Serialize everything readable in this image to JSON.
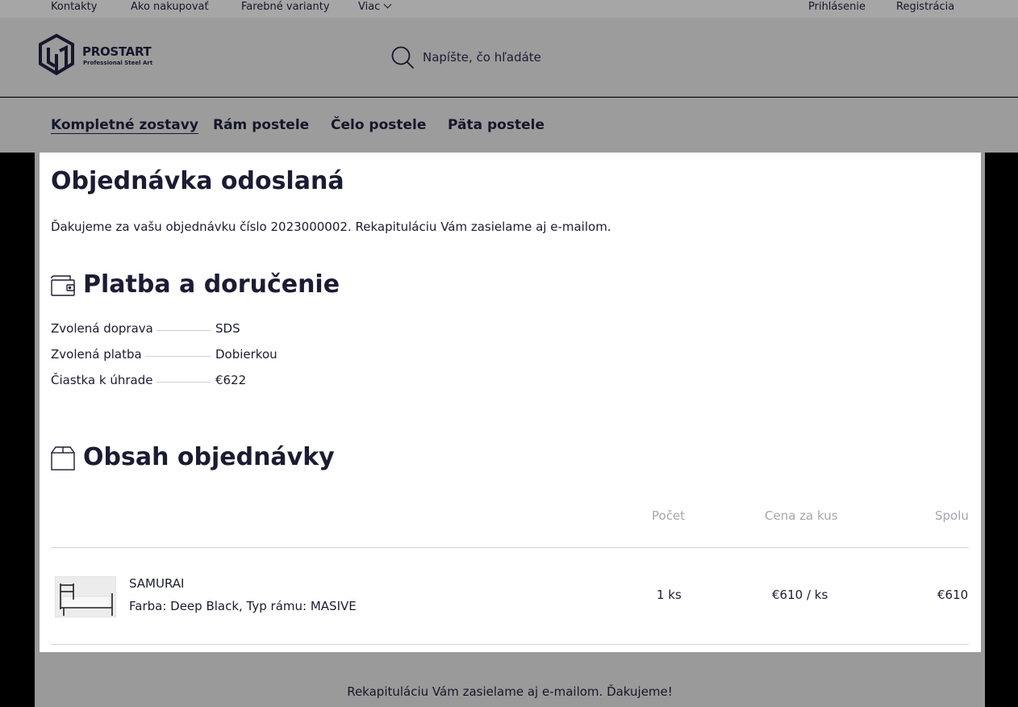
{
  "topbar": {
    "links": [
      "Kontakty",
      "Ako nakupovať",
      "Farebné varianty",
      "Viac"
    ],
    "login": "Prihlásenie",
    "register": "Registrácia"
  },
  "logo": {
    "name": "PROSTART",
    "tagline": "Professional Steel Art"
  },
  "search": {
    "placeholder": "Napíšte, čo hľadáte"
  },
  "nav": {
    "items": [
      "Kompletné zostavy",
      "Rám postele",
      "Čelo postele",
      "Päta postele"
    ],
    "active_index": 0
  },
  "confirmation": {
    "title": "Objednávka odoslaná",
    "message": "Ďakujeme za vašu objednávku číslo 2023000002. Rekapituláciu Vám zasielame aj e-mailom."
  },
  "payment": {
    "heading": "Platba a doručenie",
    "rows": [
      {
        "label": "Zvolená doprava",
        "value": "SDS"
      },
      {
        "label": "Zvolená platba",
        "value": "Dobierkou"
      },
      {
        "label": "Čiastka k úhrade",
        "value": "€622"
      }
    ]
  },
  "order": {
    "heading": "Obsah objednávky",
    "columns": {
      "qty": "Počet",
      "unit_price": "Cena za kus",
      "total": "Spolu"
    },
    "items": [
      {
        "name": "SAMURAI",
        "attributes": "Farba: Deep Black, Typ rámu: MASIVE",
        "qty": "1 ks",
        "unit_price": "€610 / ks",
        "total": "€610"
      }
    ]
  },
  "footer": {
    "message": "Rekapituláciu Vám zasielame aj e-mailom. Ďakujeme!"
  },
  "colors": {
    "text": "#1b1c33",
    "overlay_gray": "#9c9c9c",
    "muted": "#a6a6ad"
  }
}
